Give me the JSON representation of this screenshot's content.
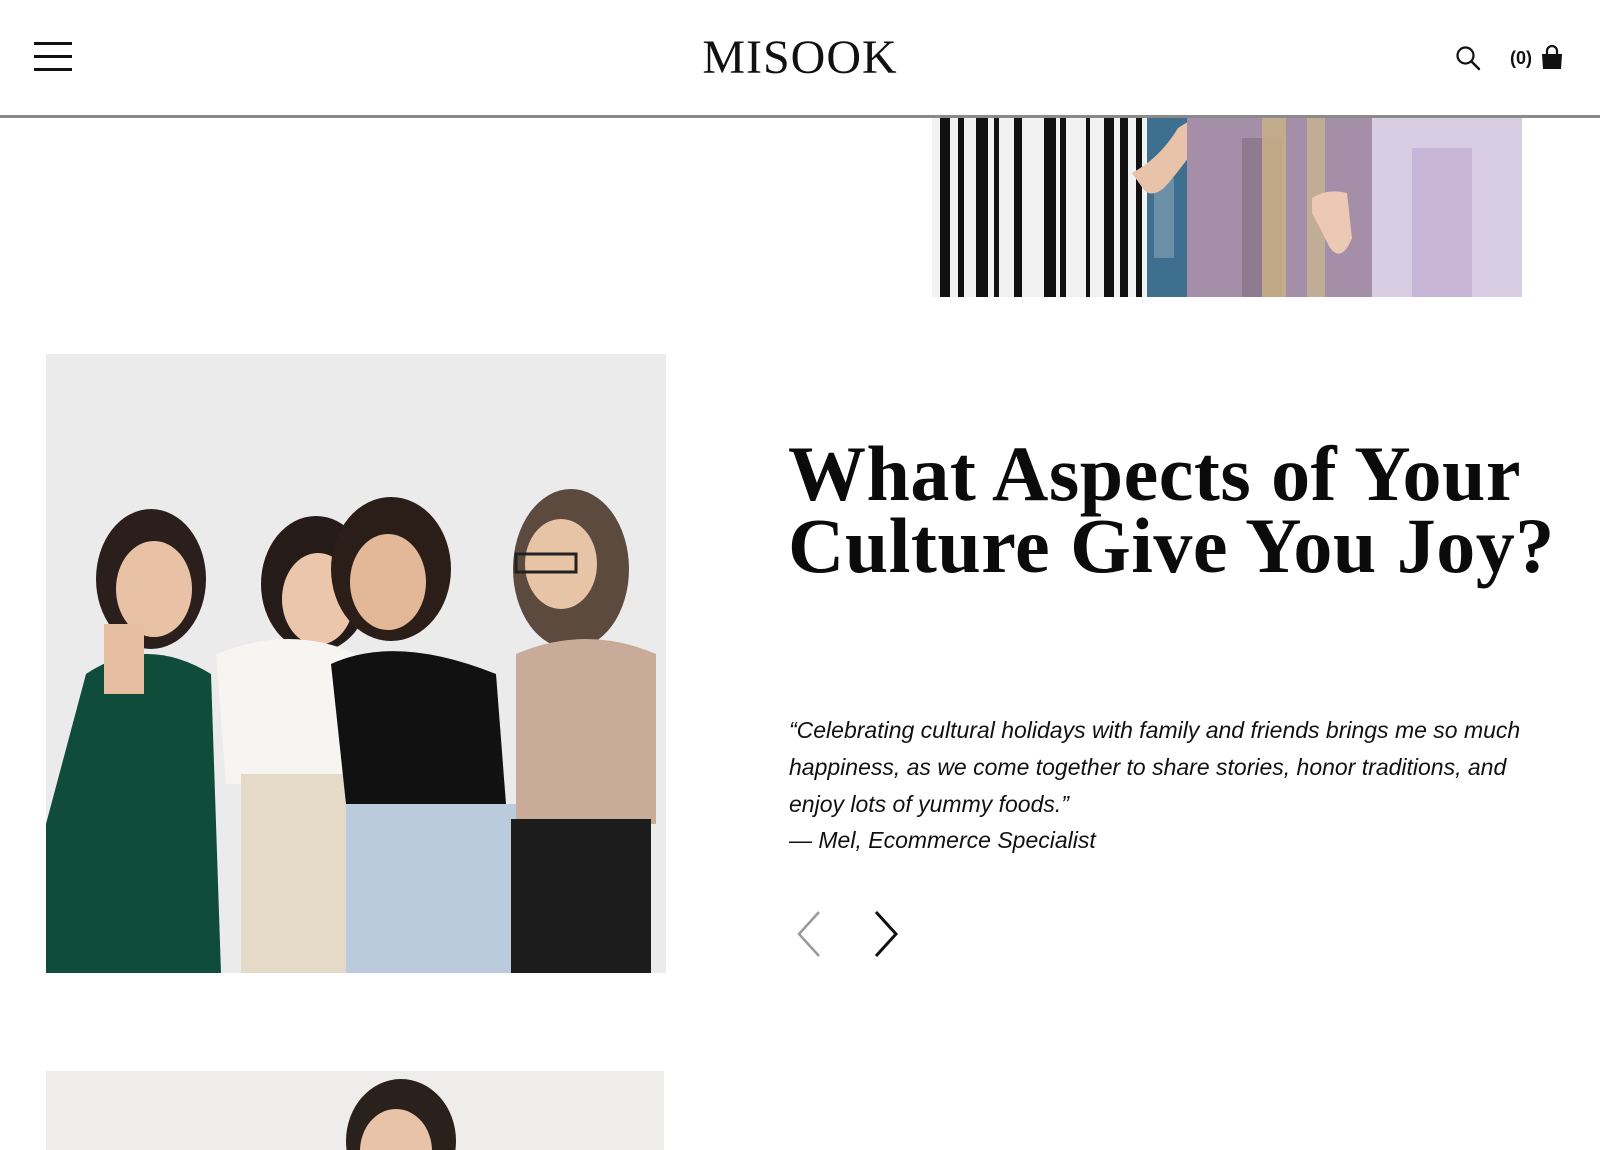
{
  "header": {
    "logo_text": "MISOOK",
    "cart_count": "(0)",
    "menu_icon": "hamburger-icon",
    "search_icon": "search-icon",
    "cart_icon": "shopping-bag-icon"
  },
  "feature": {
    "heading": "What Aspects of Your Culture Give You Joy?",
    "quote": "“Celebrating cultural holidays with family and friends brings me so much happiness, as we come together to share stories, honor traditions, and enjoy lots of yummy foods.”",
    "attribution": "— Mel, Ecommerce Specialist"
  },
  "carousel": {
    "prev_icon": "chevron-left-icon",
    "next_icon": "chevron-right-icon"
  },
  "colors": {
    "text": "#111111",
    "header_border": "#8a8a8a",
    "prev_arrow": "#9a9a9a",
    "next_arrow": "#111111"
  }
}
